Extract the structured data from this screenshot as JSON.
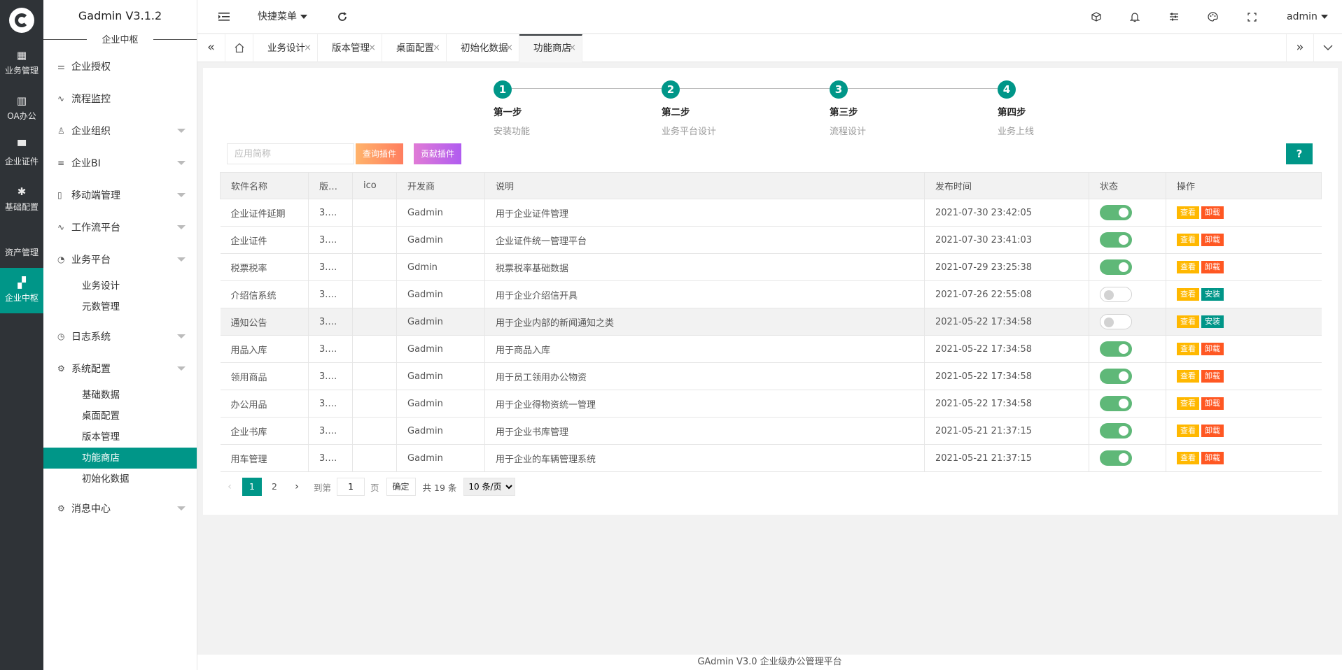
{
  "rail": [
    {
      "icon": "grid-icon",
      "glyph": "▦",
      "label": "业务管理"
    },
    {
      "icon": "building-icon",
      "glyph": "▥",
      "label": "OA办公"
    },
    {
      "icon": "certificate-icon",
      "glyph": "▀",
      "label": "企业证件"
    },
    {
      "icon": "gear-icon",
      "glyph": "✱",
      "label": "基础配置"
    },
    {
      "icon": "",
      "glyph": "",
      "label": "资产管理"
    },
    {
      "icon": "dashboard-icon",
      "glyph": "▞",
      "label": "企业中枢"
    }
  ],
  "sidebar": {
    "title": "Gadmin V3.1.2",
    "subtitle": "企业中枢",
    "items": [
      {
        "label": "企业授权",
        "icon": "sliders-icon",
        "glyph": "⚌",
        "expandable": false
      },
      {
        "label": "流程监控",
        "icon": "pulse-icon",
        "glyph": "∿",
        "expandable": false
      },
      {
        "label": "企业组织",
        "icon": "user-icon",
        "glyph": "♙",
        "expandable": true
      },
      {
        "label": "企业BI",
        "icon": "list-icon",
        "glyph": "≡",
        "expandable": true
      },
      {
        "label": "移动端管理",
        "icon": "mobile-icon",
        "glyph": "▯",
        "expandable": true
      },
      {
        "label": "工作流平台",
        "icon": "pulse-icon",
        "glyph": "∿",
        "expandable": true
      },
      {
        "label": "业务平台",
        "icon": "compass-icon",
        "glyph": "◔",
        "expandable": true,
        "children": [
          "业务设计",
          "元数管理"
        ]
      },
      {
        "label": "日志系统",
        "icon": "clock-icon",
        "glyph": "◷",
        "expandable": true
      },
      {
        "label": "系统配置",
        "icon": "gear-icon",
        "glyph": "⚙",
        "expandable": true,
        "children": [
          "基础数据",
          "桌面配置",
          "版本管理",
          "功能商店",
          "初始化数据"
        ]
      },
      {
        "label": "消息中心",
        "icon": "gear-icon",
        "glyph": "⚙",
        "expandable": true
      }
    ],
    "active_child": "功能商店"
  },
  "header": {
    "quick_menu": "快捷菜单",
    "user": "admin"
  },
  "tabs": [
    {
      "label": "业务设计"
    },
    {
      "label": "版本管理"
    },
    {
      "label": "桌面配置"
    },
    {
      "label": "初始化数据"
    },
    {
      "label": "功能商店",
      "active": true
    }
  ],
  "steps": [
    {
      "num": "1",
      "title": "第一步",
      "desc": "安装功能"
    },
    {
      "num": "2",
      "title": "第二步",
      "desc": "业务平台设计"
    },
    {
      "num": "3",
      "title": "第三步",
      "desc": "流程设计"
    },
    {
      "num": "4",
      "title": "第四步",
      "desc": "业务上线"
    }
  ],
  "toolbar": {
    "search_placeholder": "应用简称",
    "query_label": "查询插件",
    "contrib_label": "贡献插件",
    "help_label": "?"
  },
  "table": {
    "columns": [
      "软件名称",
      "版本号",
      "ico",
      "开发商",
      "说明",
      "发布时间",
      "状态",
      "操作"
    ],
    "rows": [
      {
        "name": "企业证件延期",
        "version": "3.…",
        "ico": "",
        "dev": "Gadmin",
        "desc": "用于企业证件管理",
        "time": "2021-07-30 23:42:05",
        "on": true,
        "action": "卸载"
      },
      {
        "name": "企业证件",
        "version": "3.…",
        "ico": "",
        "dev": "Gadmin",
        "desc": "企业证件统一管理平台",
        "time": "2021-07-30 23:41:03",
        "on": true,
        "action": "卸载"
      },
      {
        "name": "税票税率",
        "version": "3.…",
        "ico": "",
        "dev": "Gdmin",
        "desc": "税票税率基础数据",
        "time": "2021-07-29 23:25:38",
        "on": true,
        "action": "卸载"
      },
      {
        "name": "介绍信系统",
        "version": "3.…",
        "ico": "",
        "dev": "Gadmin",
        "desc": "用于企业介绍信开具",
        "time": "2021-07-26 22:55:08",
        "on": false,
        "action": "安装"
      },
      {
        "name": "通知公告",
        "version": "3.…",
        "ico": "",
        "dev": "Gadmin",
        "desc": "用于企业内部的新闻通知之类",
        "time": "2021-05-22 17:34:58",
        "on": false,
        "action": "安装"
      },
      {
        "name": "用品入库",
        "version": "3.…",
        "ico": "",
        "dev": "Gadmin",
        "desc": "用于商品入库",
        "time": "2021-05-22 17:34:58",
        "on": true,
        "action": "卸载"
      },
      {
        "name": "领用商品",
        "version": "3.…",
        "ico": "",
        "dev": "Gadmin",
        "desc": "用于员工领用办公物资",
        "time": "2021-05-22 17:34:58",
        "on": true,
        "action": "卸载"
      },
      {
        "name": "办公用品",
        "version": "3.…",
        "ico": "",
        "dev": "Gadmin",
        "desc": "用于企业得物资统一管理",
        "time": "2021-05-22 17:34:58",
        "on": true,
        "action": "卸载"
      },
      {
        "name": "企业书库",
        "version": "3.…",
        "ico": "",
        "dev": "Gadmin",
        "desc": "用于企业书库管理",
        "time": "2021-05-21 21:37:15",
        "on": true,
        "action": "卸载"
      },
      {
        "name": "用车管理",
        "version": "3.…",
        "ico": "",
        "dev": "Gadmin",
        "desc": "用于企业的车辆管理系统",
        "time": "2021-05-21 21:37:15",
        "on": true,
        "action": "卸载"
      }
    ],
    "view_label": "查看"
  },
  "pager": {
    "pages": [
      "1",
      "2"
    ],
    "current": "1",
    "goto_label": "到第",
    "goto_value": "1",
    "page_unit": "页",
    "confirm_label": "确定",
    "total": "共 19 条",
    "size_option": "10 条/页"
  },
  "footer": "GAdmin V3.0 企业级办公管理平台"
}
